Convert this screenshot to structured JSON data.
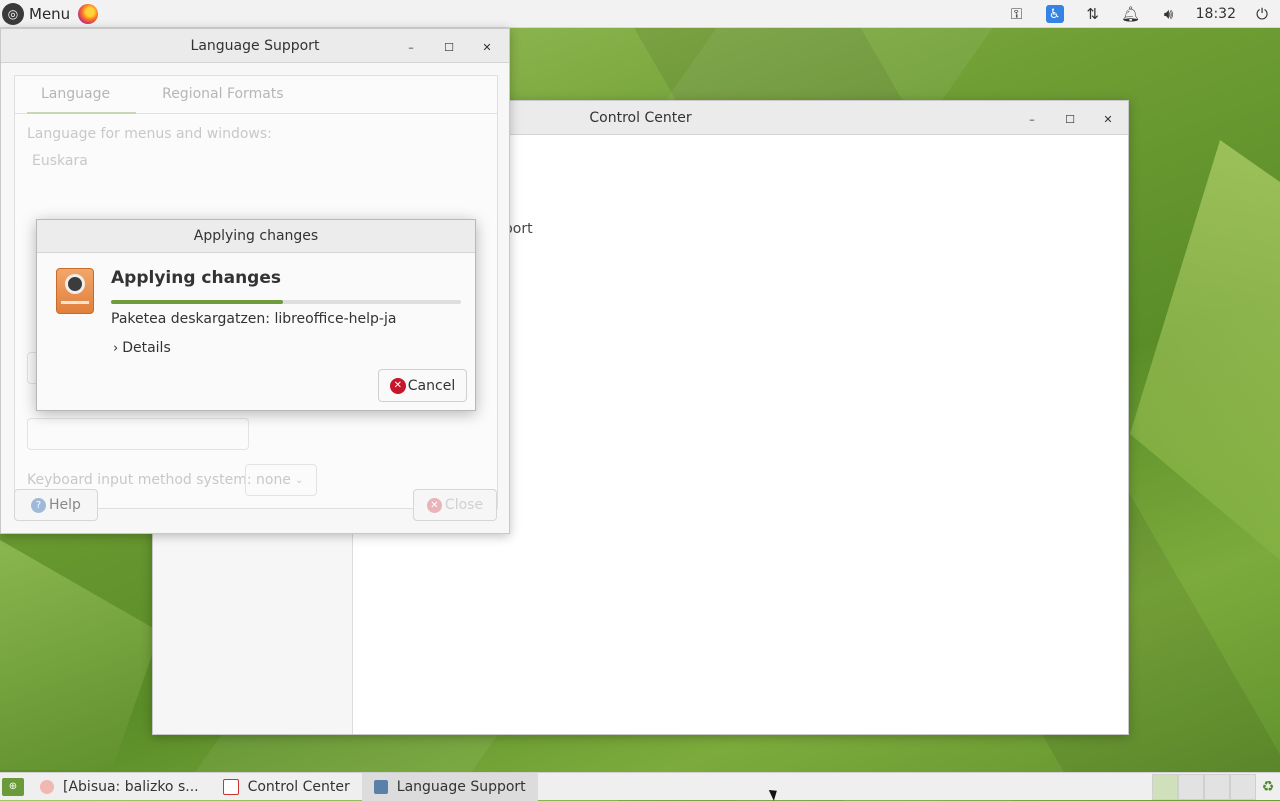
{
  "top_panel": {
    "menu_label": "Menu",
    "clock": "18:32"
  },
  "control_center": {
    "title": "Control Center",
    "partial_text": "pport"
  },
  "language_support": {
    "title": "Language Support",
    "tabs": [
      {
        "label": "Language"
      },
      {
        "label": "Regional Formats"
      }
    ],
    "language_label": "Language for menus and windows:",
    "language_value": "Euskara",
    "keyboard_label": "Keyboard input method system:",
    "keyboard_value": "none",
    "help_label": "Help",
    "close_label": "Close"
  },
  "dialog": {
    "title": "Applying changes",
    "heading": "Applying changes",
    "status": "Paketea deskargatzen: libreoffice-help-ja",
    "progress": 0.49,
    "details_label": "Details",
    "cancel_label": "Cancel"
  },
  "taskbar": {
    "tasks": [
      {
        "label": "[Abisua: balizko s..."
      },
      {
        "label": "Control Center"
      },
      {
        "label": "Language Support"
      }
    ]
  },
  "colors": {
    "accent": "#6f9b3c",
    "cancel_icon": "#c7162b",
    "a11y": "#3584e4"
  }
}
